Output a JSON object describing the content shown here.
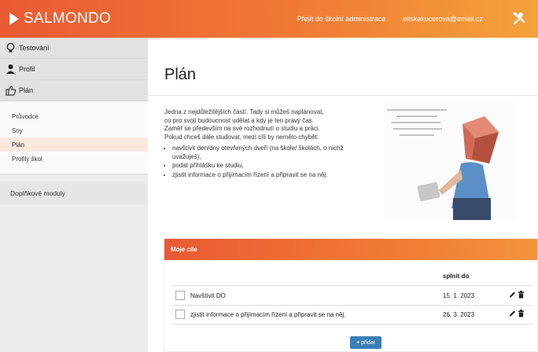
{
  "header": {
    "brand": "SALMONDO",
    "admin_link": "Přejít do školní administrace",
    "user_email": "eliskakucerova@email.cz",
    "icon": "tools-icon"
  },
  "sidebar": {
    "main_items": [
      {
        "label": "Testování",
        "icon": "lightbulb-icon"
      },
      {
        "label": "Profil",
        "icon": "user-icon"
      },
      {
        "label": "Plán",
        "icon": "thumbs-up-icon"
      }
    ],
    "sub_items": [
      {
        "label": "Průvodce"
      },
      {
        "label": "Sny"
      },
      {
        "label": "Plán",
        "active": true
      },
      {
        "label": "Profily škol"
      }
    ],
    "module": "Doplňkové moduly"
  },
  "main": {
    "title": "Plán",
    "intro_lines": [
      "Jedna z nejdůležitějších částí. Tady si můžeš naplánovat,",
      "co pro svoji budoucnost udělat a kdy je ten pravý čas.",
      "Zaměř se především na své rozhodnutí o studiu a práci.",
      "Pokud chceš dále studovat, mezi cíli by nemělo chybět:"
    ],
    "bullets": [
      "navštívit den/dny otevřených dveří (na škole/ školách, o nichž uvažuješ),",
      "podat přihlášku ke studiu,",
      "zjistit informace o přijímacím řízení a připravit se na něj."
    ]
  },
  "goals": {
    "panel_title": "Moje cíle",
    "deadline_header": "splnit do",
    "rows": [
      {
        "name": "Navštívit DO",
        "date": "15. 1. 2023",
        "checked": false
      },
      {
        "name": "zjistit informace o přijímacím řízení a připravit se na něj.",
        "date": "26. 3. 2023",
        "checked": false
      }
    ],
    "add_label": "přidat"
  },
  "colors": {
    "accent": "#ef6a34",
    "button": "#3a7fb5"
  }
}
